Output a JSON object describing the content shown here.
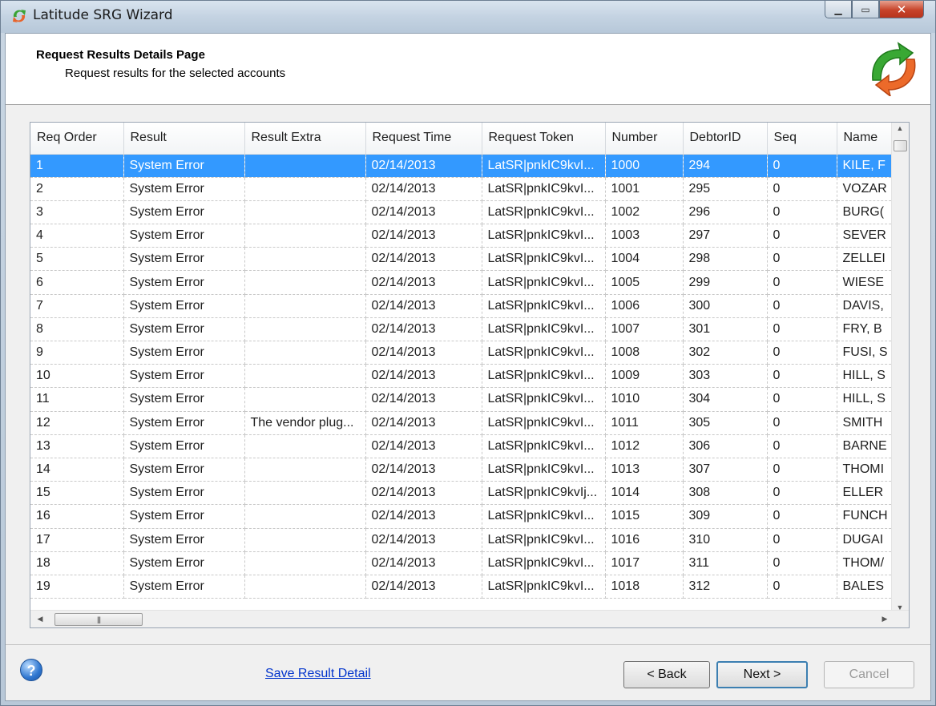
{
  "window": {
    "title": "Latitude SRG Wizard"
  },
  "header": {
    "title": "Request Results Details Page",
    "subtitle": "Request results for the selected accounts"
  },
  "grid": {
    "columns": [
      "Req Order",
      "Result",
      "Result Extra",
      "Request Time",
      "Request Token",
      "Number",
      "DebtorID",
      "Seq",
      "Name"
    ],
    "rows": [
      [
        "1",
        "System Error",
        "",
        "02/14/2013",
        "LatSR|pnkIC9kvI...",
        "1000",
        "294",
        "0",
        "KILE, F"
      ],
      [
        "2",
        "System Error",
        "",
        "02/14/2013",
        "LatSR|pnkIC9kvI...",
        "1001",
        "295",
        "0",
        "VOZAR"
      ],
      [
        "3",
        "System Error",
        "",
        "02/14/2013",
        "LatSR|pnkIC9kvI...",
        "1002",
        "296",
        "0",
        "BURG("
      ],
      [
        "4",
        "System Error",
        "",
        "02/14/2013",
        "LatSR|pnkIC9kvI...",
        "1003",
        "297",
        "0",
        "SEVER"
      ],
      [
        "5",
        "System Error",
        "",
        "02/14/2013",
        "LatSR|pnkIC9kvI...",
        "1004",
        "298",
        "0",
        "ZELLEI"
      ],
      [
        "6",
        "System Error",
        "",
        "02/14/2013",
        "LatSR|pnkIC9kvI...",
        "1005",
        "299",
        "0",
        "WIESE"
      ],
      [
        "7",
        "System Error",
        "",
        "02/14/2013",
        "LatSR|pnkIC9kvI...",
        "1006",
        "300",
        "0",
        "DAVIS,"
      ],
      [
        "8",
        "System Error",
        "",
        "02/14/2013",
        "LatSR|pnkIC9kvI...",
        "1007",
        "301",
        "0",
        "FRY, B"
      ],
      [
        "9",
        "System Error",
        "",
        "02/14/2013",
        "LatSR|pnkIC9kvI...",
        "1008",
        "302",
        "0",
        "FUSI, S"
      ],
      [
        "10",
        "System Error",
        "",
        "02/14/2013",
        "LatSR|pnkIC9kvI...",
        "1009",
        "303",
        "0",
        "HILL, S"
      ],
      [
        "11",
        "System Error",
        "",
        "02/14/2013",
        "LatSR|pnkIC9kvI...",
        "1010",
        "304",
        "0",
        "HILL, S"
      ],
      [
        "12",
        "System Error",
        "The vendor plug...",
        "02/14/2013",
        "LatSR|pnkIC9kvI...",
        "1011",
        "305",
        "0",
        "SMITH"
      ],
      [
        "13",
        "System Error",
        "",
        "02/14/2013",
        "LatSR|pnkIC9kvI...",
        "1012",
        "306",
        "0",
        "BARNE"
      ],
      [
        "14",
        "System Error",
        "",
        "02/14/2013",
        "LatSR|pnkIC9kvI...",
        "1013",
        "307",
        "0",
        "THOMI"
      ],
      [
        "15",
        "System Error",
        "",
        "02/14/2013",
        "LatSR|pnkIC9kvIj...",
        "1014",
        "308",
        "0",
        "ELLER"
      ],
      [
        "16",
        "System Error",
        "",
        "02/14/2013",
        "LatSR|pnkIC9kvI...",
        "1015",
        "309",
        "0",
        "FUNCH"
      ],
      [
        "17",
        "System Error",
        "",
        "02/14/2013",
        "LatSR|pnkIC9kvI...",
        "1016",
        "310",
        "0",
        "DUGAI"
      ],
      [
        "18",
        "System Error",
        "",
        "02/14/2013",
        "LatSR|pnkIC9kvI...",
        "1017",
        "311",
        "0",
        "THOM/"
      ],
      [
        "19",
        "System Error",
        "",
        "02/14/2013",
        "LatSR|pnkIC9kvI...",
        "1018",
        "312",
        "0",
        "BALES"
      ]
    ],
    "selected_row": 0
  },
  "footer": {
    "help_label": "?",
    "save_link": "Save Result Detail",
    "back_label": "< Back",
    "next_label": "Next >",
    "cancel_label": "Cancel"
  },
  "colors": {
    "selection": "#3399ff",
    "link": "#0033cc"
  },
  "icons": {
    "app": "srg-wizard-icon",
    "logo": "green-orange-arrows-icon",
    "help": "help-icon"
  }
}
